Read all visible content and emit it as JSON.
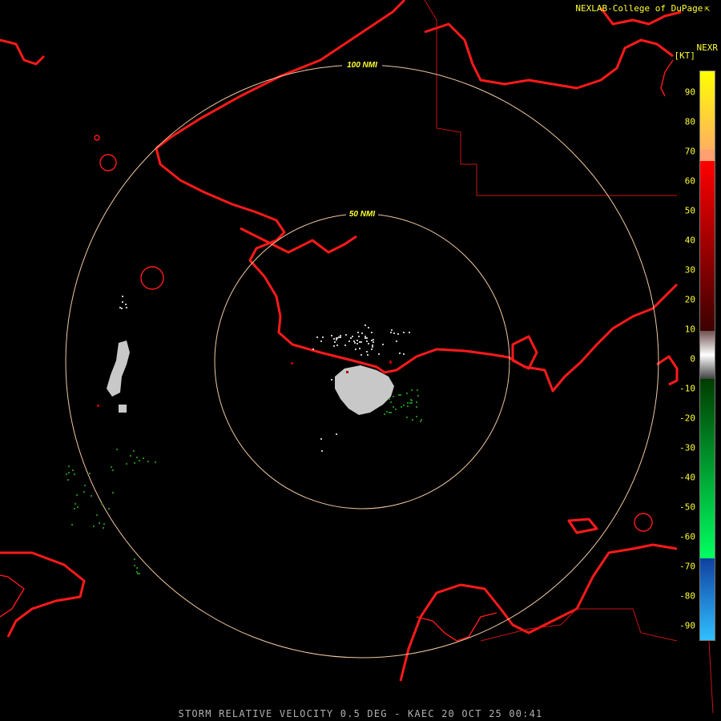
{
  "header": {
    "credit": "NEXLAB-College of DuPage",
    "credit_icon": "external-link-icon",
    "product": "NEXR",
    "unit": "[KT]"
  },
  "rings": {
    "inner_label": "50 NMI",
    "outer_label": "100 NMI"
  },
  "legend": {
    "ticks": [
      "90",
      "80",
      "70",
      "60",
      "50",
      "40",
      "30",
      "20",
      "10",
      "0",
      "-10",
      "-20",
      "-30",
      "-40",
      "-50",
      "-60",
      "-70",
      "-80",
      "-90"
    ],
    "colors": {
      "outbound_max": "#ffff00",
      "outbound_high": "#ffb060",
      "outbound_red": "#ff0000",
      "near_zero": "#c0c0c0",
      "inbound_green": "#00a000",
      "inbound_blue": "#2080ff"
    }
  },
  "map_colors": {
    "coast": "#ff1a1a",
    "border": "#c81414",
    "range_ring": "#f0c8a0",
    "echo_gray": "#c8c8c8",
    "echo_green": "#1c8a1c"
  },
  "footer": {
    "caption": "STORM RELATIVE VELOCITY 0.5 DEG - KAEC 20 OCT 25 00:41"
  }
}
